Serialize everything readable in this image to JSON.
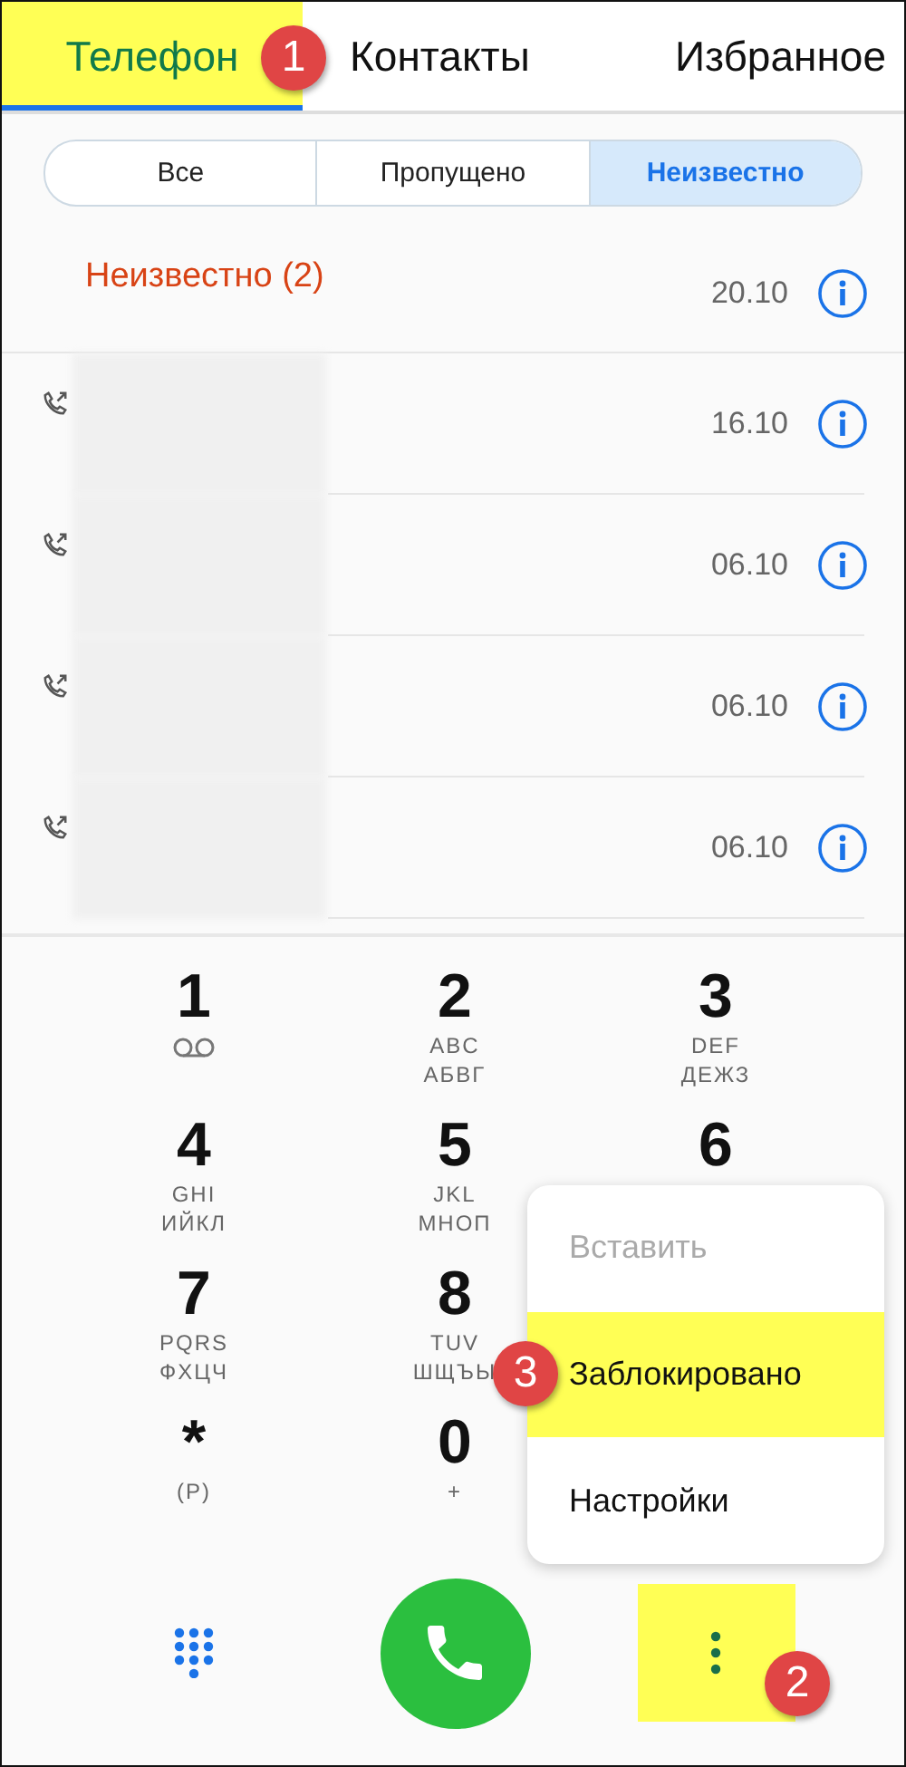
{
  "tabs": [
    {
      "label": "Телефон",
      "selected": true,
      "highlighted": true
    },
    {
      "label": "Контакты",
      "selected": false,
      "highlighted": false
    },
    {
      "label": "Избранное",
      "selected": false,
      "highlighted": false
    }
  ],
  "filters": [
    {
      "label": "Все",
      "selected": false
    },
    {
      "label": "Пропущено",
      "selected": false
    },
    {
      "label": "Неизвестно",
      "selected": true
    }
  ],
  "call_log": {
    "group_label": "Неизвестно (2)",
    "group_date": "20.10",
    "rows": [
      {
        "date": "16.10"
      },
      {
        "date": "06.10"
      },
      {
        "date": "06.10"
      },
      {
        "date": "06.10"
      }
    ]
  },
  "keypad": [
    {
      "digit": "1",
      "kind": "voicemail"
    },
    {
      "digit": "2",
      "kind": "letters",
      "letters": [
        "ABC",
        "АБВГ"
      ]
    },
    {
      "digit": "3",
      "kind": "letters",
      "letters": [
        "DEF",
        "ДЕЖЗ"
      ]
    },
    {
      "digit": "4",
      "kind": "letters",
      "letters": [
        "GHI",
        "ИЙКЛ"
      ]
    },
    {
      "digit": "5",
      "kind": "letters",
      "letters": [
        "JKL",
        "МНОП"
      ]
    },
    {
      "digit": "6",
      "kind": "covered"
    },
    {
      "digit": "7",
      "kind": "letters",
      "letters": [
        "PQRS",
        "ФХЦЧ"
      ]
    },
    {
      "digit": "8",
      "kind": "letters",
      "letters": [
        "TUV",
        "ШЩЪЫ"
      ]
    },
    {
      "digit": "*",
      "kind": "letters",
      "letters": [
        "(P)"
      ],
      "new_row": true
    },
    {
      "digit": "0",
      "kind": "letters",
      "letters": [
        "+"
      ]
    }
  ],
  "menu": [
    {
      "label": "Вставить",
      "disabled": true,
      "highlighted": false
    },
    {
      "label": "Заблокировано",
      "disabled": false,
      "highlighted": true
    },
    {
      "label": "Настройки",
      "disabled": false,
      "highlighted": false
    }
  ],
  "more_button": {
    "highlighted": true
  },
  "step_markers": [
    {
      "number": "1",
      "kind": "tab"
    },
    {
      "number": "2",
      "kind": "more"
    },
    {
      "number": "3",
      "kind": "menu"
    }
  ]
}
